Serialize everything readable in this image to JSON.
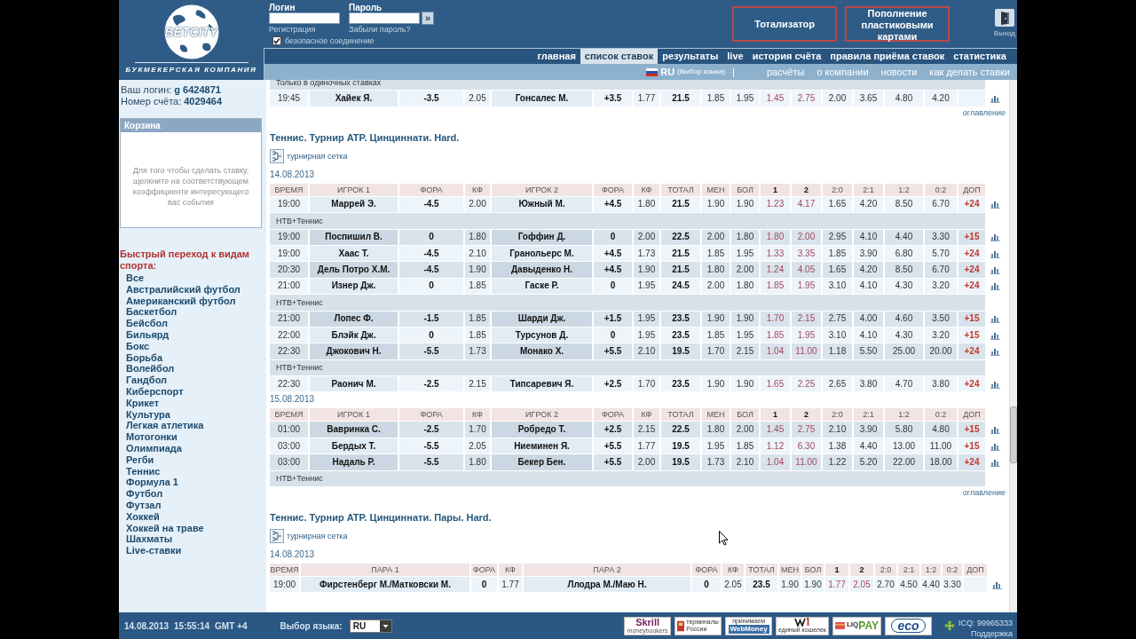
{
  "header": {
    "logo": {
      "name": "BETCITY",
      "tagline": "БУКМЕКЕРСКАЯ КОМПАНИЯ"
    },
    "login": {
      "login_label": "Логин",
      "password_label": "Пароль",
      "submit": "»",
      "register_link": "Регистрация",
      "forgot_link": "Забыли пароль?",
      "secure": {
        "label": "безопасное соединение",
        "checked": true
      }
    },
    "buttons": [
      "Тотализатор",
      "Пополнение пластиковыми картами"
    ],
    "exit": "Выход"
  },
  "nav": [
    {
      "label": "главная",
      "selected": false
    },
    {
      "label": "список ставок",
      "selected": true
    },
    {
      "label": "результаты",
      "selected": false
    },
    {
      "label": "live",
      "selected": false
    },
    {
      "label": "история счёта",
      "selected": false
    },
    {
      "label": "правила приёма ставок",
      "selected": false
    },
    {
      "label": "статистика",
      "selected": false
    }
  ],
  "subnav": {
    "language": {
      "code": "RU",
      "hint": "(Выбор языка)"
    },
    "separator": "|",
    "links": [
      "расчёты",
      "о компании",
      "новости",
      "как делать ставки"
    ]
  },
  "sidebar": {
    "account": [
      {
        "label": "Ваш логин:",
        "value": "g 6424871"
      },
      {
        "label": "Номер счёта:",
        "value": "4029464"
      }
    ],
    "basket": {
      "title": "Корзина",
      "hint": "Для того чтобы сделать ставку, щелкните на соответствующем коэффициенте интересующего вас события"
    },
    "quick_nav": {
      "title": "Быстрый переход к видам спорта:",
      "items": [
        "Все",
        "Австралийский футбол",
        "Американский футбол",
        "Баскетбол",
        "Бейсбол",
        "Бильярд",
        "Бокс",
        "Борьба",
        "Волейбол",
        "Гандбол",
        "Киберспорт",
        "Крикет",
        "Культура",
        "Легкая атлетика",
        "Мотогонки",
        "Олимпиада",
        "Регби",
        "Теннис",
        "Формула 1",
        "Футбол",
        "Футзал",
        "Хоккей",
        "Хоккей на траве",
        "Шахматы",
        "Live-ставки"
      ]
    }
  },
  "events": [
    {
      "kind": "singles",
      "groups": [
        {
          "rows": [
            {
              "kind": "note",
              "text": "Только в одиночных ставках"
            },
            {
              "kind": "match",
              "cells": [
                "19:45",
                "Хайек Я.",
                "-3.5",
                "2.05",
                "Гонсалес М.",
                "+3.5",
                "1.77",
                "21.5",
                "1.85",
                "1.95",
                "1.45",
                "2.75",
                "2.00",
                "3.65",
                "4.80",
                "4.20"
              ]
            }
          ]
        }
      ],
      "toc_link": "оглавление"
    },
    {
      "kind": "singles",
      "title": "Теннис. Турнир ATP. Цинциннати. Hard.",
      "bracket_link": "турнирная сетка",
      "groups": [
        {
          "date": "14.08.2013",
          "columns": [
            "ВРЕМЯ",
            "ИГРОК 1",
            "ФОРА",
            "КФ",
            "ИГРОК 2",
            "ФОРА",
            "КФ",
            "ТОТАЛ",
            "МЕН",
            "БОЛ",
            "1",
            "2",
            "2:0",
            "2:1",
            "1:2",
            "0:2",
            "ДОП"
          ],
          "rows": [
            {
              "kind": "match",
              "cells": [
                "19:00",
                "Маррей Э.",
                "-4.5",
                "2.00",
                "Южный М.",
                "+4.5",
                "1.80",
                "21.5",
                "1.90",
                "1.90",
                "1.23",
                "4.17",
                "1.65",
                "4.20",
                "8.50",
                "6.70"
              ],
              "extra": "+24"
            },
            {
              "kind": "note",
              "text": "НТВ+Теннис"
            },
            {
              "kind": "match",
              "cells": [
                "19:00",
                "Поспишил В.",
                "0",
                "1.80",
                "Гоффин Д.",
                "0",
                "2.00",
                "22.5",
                "2.00",
                "1.80",
                "1.80",
                "2.00",
                "2.95",
                "4.10",
                "4.40",
                "3.30"
              ],
              "extra": "+15"
            },
            {
              "kind": "match",
              "cells": [
                "19:00",
                "Хаас Т.",
                "-4.5",
                "2.10",
                "Гранольерс М.",
                "+4.5",
                "1.73",
                "21.5",
                "1.85",
                "1.95",
                "1.33",
                "3.35",
                "1.85",
                "3.90",
                "6.80",
                "5.70"
              ],
              "extra": "+24"
            },
            {
              "kind": "match",
              "cells": [
                "20:30",
                "Дель Потро Х.М.",
                "-4.5",
                "1.90",
                "Давыденко Н.",
                "+4.5",
                "1.90",
                "21.5",
                "1.80",
                "2.00",
                "1.24",
                "4.05",
                "1.65",
                "4.20",
                "8.50",
                "6.70"
              ],
              "extra": "+24"
            },
            {
              "kind": "match",
              "cells": [
                "21:00",
                "Изнер Дж.",
                "0",
                "1.85",
                "Гаске Р.",
                "0",
                "1.95",
                "24.5",
                "2.00",
                "1.80",
                "1.85",
                "1.95",
                "3.10",
                "4.10",
                "4.30",
                "3.20"
              ],
              "extra": "+24"
            },
            {
              "kind": "note",
              "text": "НТВ+Теннис"
            },
            {
              "kind": "match",
              "cells": [
                "21:00",
                "Лопес Ф.",
                "-1.5",
                "1.85",
                "Шарди Дж.",
                "+1.5",
                "1.95",
                "23.5",
                "1.90",
                "1.90",
                "1.70",
                "2.15",
                "2.75",
                "4.00",
                "4.60",
                "3.50"
              ],
              "extra": "+15"
            },
            {
              "kind": "match",
              "cells": [
                "22:00",
                "Блэйк Дж.",
                "0",
                "1.85",
                "Турсунов Д.",
                "0",
                "1.95",
                "23.5",
                "1.85",
                "1.95",
                "1.85",
                "1.95",
                "3.10",
                "4.10",
                "4.30",
                "3.20"
              ],
              "extra": "+15"
            },
            {
              "kind": "match",
              "cells": [
                "22:30",
                "Джокович Н.",
                "-5.5",
                "1.73",
                "Монако Х.",
                "+5.5",
                "2.10",
                "19.5",
                "1.70",
                "2.15",
                "1.04",
                "11.00",
                "1.18",
                "5.50",
                "25.00",
                "20.00"
              ],
              "extra": "+24"
            },
            {
              "kind": "note",
              "text": "НТВ+Теннис"
            },
            {
              "kind": "match",
              "cells": [
                "22:30",
                "Раонич М.",
                "-2.5",
                "2.15",
                "Типсаревич Я.",
                "+2.5",
                "1.70",
                "23.5",
                "1.90",
                "1.90",
                "1.65",
                "2.25",
                "2.65",
                "3.80",
                "4.70",
                "3.80"
              ],
              "extra": "+24"
            }
          ]
        },
        {
          "date": "15.08.2013",
          "columns": [
            "ВРЕМЯ",
            "ИГРОК 1",
            "ФОРА",
            "КФ",
            "ИГРОК 2",
            "ФОРА",
            "КФ",
            "ТОТАЛ",
            "МЕН",
            "БОЛ",
            "1",
            "2",
            "2:0",
            "2:1",
            "1:2",
            "0:2",
            "ДОП"
          ],
          "rows": [
            {
              "kind": "match",
              "cells": [
                "01:00",
                "Вавринка С.",
                "-2.5",
                "1.70",
                "Робредо Т.",
                "+2.5",
                "2.15",
                "22.5",
                "1.80",
                "2.00",
                "1.45",
                "2.75",
                "2.10",
                "3.90",
                "5.80",
                "4.80"
              ],
              "extra": "+15"
            },
            {
              "kind": "match",
              "cells": [
                "03:00",
                "Бердых Т.",
                "-5.5",
                "2.05",
                "Ниеминен Я.",
                "+5.5",
                "1.77",
                "19.5",
                "1.95",
                "1.85",
                "1.12",
                "6.30",
                "1.38",
                "4.40",
                "13.00",
                "11.00"
              ],
              "extra": "+15"
            },
            {
              "kind": "match",
              "cells": [
                "03:00",
                "Надаль Р.",
                "-5.5",
                "1.80",
                "Бекер Бен.",
                "+5.5",
                "2.00",
                "19.5",
                "1.73",
                "2.10",
                "1.04",
                "11.00",
                "1.22",
                "5.20",
                "22.00",
                "18.00"
              ],
              "extra": "+24"
            },
            {
              "kind": "note",
              "text": "НТВ+Теннис"
            }
          ]
        }
      ],
      "toc_link": "оглавление"
    },
    {
      "kind": "pairs",
      "title": "Теннис. Турнир ATP. Цинциннати. Пары. Hard.",
      "bracket_link": "турнирная сетка",
      "groups": [
        {
          "date": "14.08.2013",
          "columns": [
            "ВРЕМЯ",
            "ПАРА 1",
            "ФОРА",
            "КФ",
            "ПАРА 2",
            "ФОРА",
            "КФ",
            "ТОТАЛ",
            "МЕН",
            "БОЛ",
            "1",
            "2",
            "2:0",
            "2:1",
            "1:2",
            "0:2",
            "ДОП"
          ],
          "rows": [
            {
              "kind": "match",
              "cells": [
                "19:00",
                "Фирстенберг М./Матковски М.",
                "0",
                "1.77",
                "Ллодра М./Маю Н.",
                "0",
                "2.05",
                "23.5",
                "1.90",
                "1.90",
                "1.77",
                "2.05",
                "2.70",
                "4.50",
                "4.40",
                "3.30"
              ]
            }
          ]
        }
      ]
    }
  ],
  "footer": {
    "date": "14.08.2013",
    "time": "15:55:14",
    "timezone": "GMT +4",
    "language_label": "Выбор языка:",
    "language": "RU",
    "payment_logos": [
      {
        "kind": "skrill",
        "lines": [
          "Skrill",
          "moneybookers"
        ]
      },
      {
        "kind": "terminals",
        "lines": [
          "терминалы",
          "России"
        ]
      },
      {
        "kind": "webmoney",
        "lines": [
          "принимаем",
          "WebMoney"
        ]
      },
      {
        "kind": "w1",
        "lines": [
          "единый кошелек"
        ]
      },
      {
        "kind": "liqpay",
        "lines": [
          "LIQ",
          "PAY"
        ]
      },
      {
        "kind": "eco",
        "lines": [
          "eco"
        ]
      }
    ],
    "icq": "ICQ: 99965333",
    "support": "Поддержка"
  }
}
